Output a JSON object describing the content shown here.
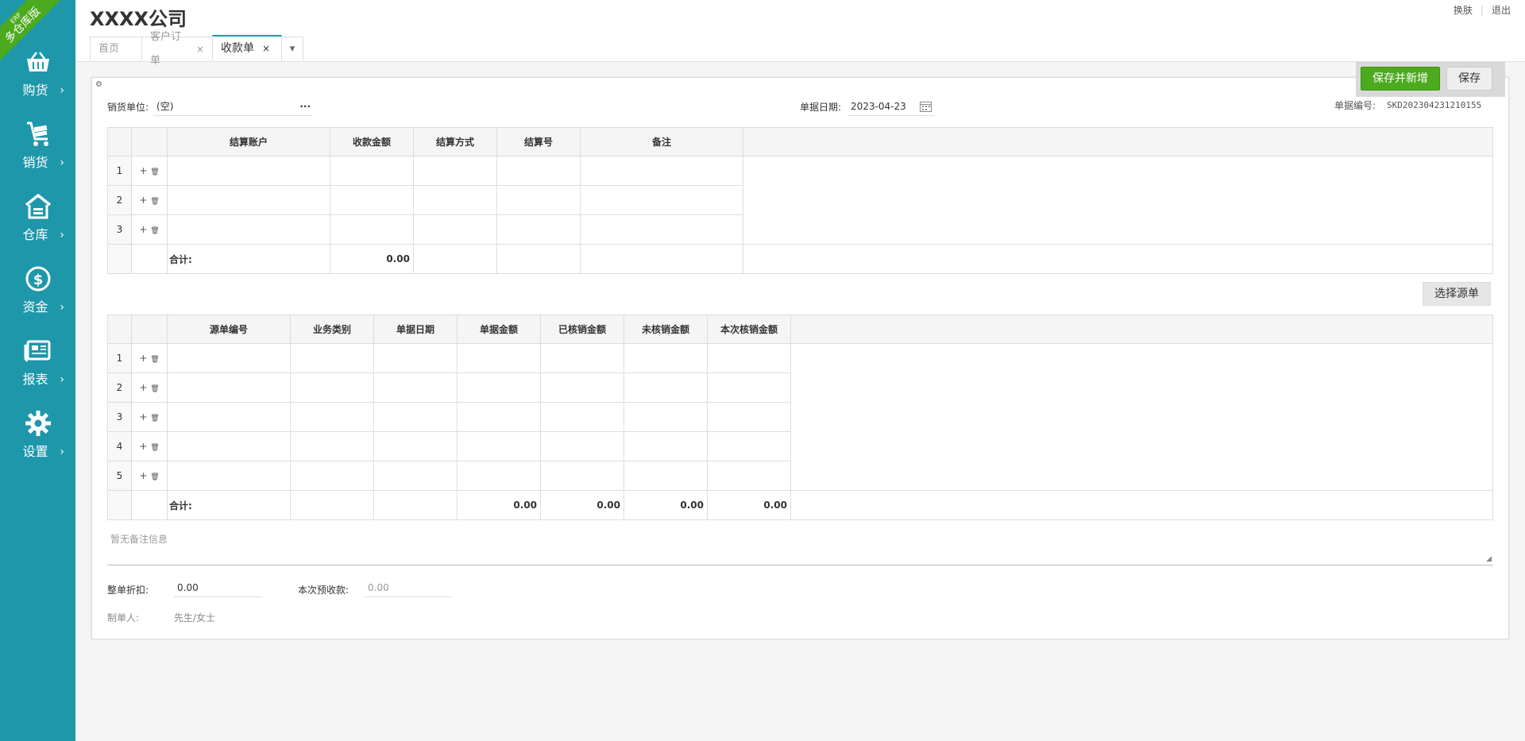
{
  "sidebar": {
    "ribbon_small": "ERP",
    "ribbon_main": "多仓库版",
    "items": [
      {
        "label": "购货"
      },
      {
        "label": "销货"
      },
      {
        "label": "仓库"
      },
      {
        "label": "资金"
      },
      {
        "label": "报表"
      },
      {
        "label": "设置"
      }
    ],
    "arrow": "›"
  },
  "header": {
    "company": "XXXX公司",
    "links": {
      "switch": "换肤",
      "logout": "退出"
    },
    "tabs": [
      {
        "label": "首页",
        "closable": false
      },
      {
        "label": "客户订单",
        "closable": true
      },
      {
        "label": "收款单",
        "closable": true,
        "active": true
      }
    ],
    "close_glyph": "×",
    "dropdown_glyph": "▾"
  },
  "actions": {
    "save_new": "保存并新增",
    "save": "保存"
  },
  "form": {
    "customer_label": "销货单位:",
    "customer_value": "(空)",
    "more_glyph": "···",
    "date_label": "单据日期:",
    "date_value": "2023-04-23",
    "no_label": "单据编号:",
    "no_value": "SKD202304231210155"
  },
  "settlement_table": {
    "headers": [
      "结算账户",
      "收款金额",
      "结算方式",
      "结算号",
      "备注"
    ],
    "rows": [
      "1",
      "2",
      "3"
    ],
    "total_label": "合计:",
    "total_amount": "0.00"
  },
  "select_source": "选择源单",
  "source_table": {
    "headers": [
      "源单编号",
      "业务类别",
      "单据日期",
      "单据金额",
      "已核销金额",
      "未核销金额",
      "本次核销金额"
    ],
    "rows": [
      "1",
      "2",
      "3",
      "4",
      "5"
    ],
    "total_label": "合计:",
    "totals": [
      "0.00",
      "0.00",
      "0.00",
      "0.00"
    ]
  },
  "ops": {
    "add": "+",
    "delete": "🗑"
  },
  "remark_placeholder": "暂无备注信息",
  "footer": {
    "discount_label": "整单折扣:",
    "discount_value": "0.00",
    "prepay_label": "本次预收款:",
    "prepay_value": "0.00",
    "maker_label": "制单人:",
    "maker_value": "先生/女士"
  }
}
